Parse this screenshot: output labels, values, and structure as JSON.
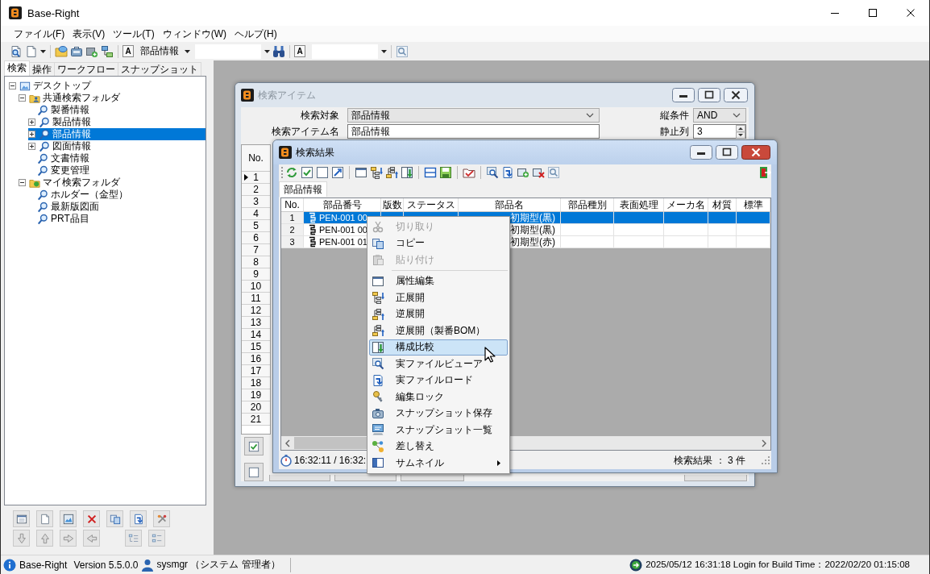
{
  "window": {
    "title": "Base-Right"
  },
  "menu_bar": [
    "ファイル(F)",
    "表示(V)",
    "ツール(T)",
    "ウィンドウ(W)",
    "ヘルプ(H)"
  ],
  "toolbar": {
    "letter_buttons": [
      "A",
      "A"
    ],
    "category_dropdown": "部品情報"
  },
  "side_tabs": [
    {
      "label": "検索",
      "selected": true
    },
    {
      "label": "操作",
      "selected": false
    },
    {
      "label": "ワークフロー",
      "selected": false
    },
    {
      "label": "スナップショット",
      "selected": false
    }
  ],
  "tree": [
    {
      "label": "デスクトップ",
      "kind": "desktop",
      "expanded": true,
      "selected": false,
      "children": [
        {
          "label": "共通検索フォルダ",
          "kind": "shared_folder",
          "expanded": true,
          "selected": false,
          "children": [
            {
              "label": "製番情報",
              "kind": "query",
              "selected": false
            },
            {
              "label": "製品情報",
              "kind": "query",
              "expanded": false,
              "selected": false
            },
            {
              "label": "部品情報",
              "kind": "query",
              "expanded": false,
              "selected": true
            },
            {
              "label": "図面情報",
              "kind": "query",
              "expanded": false,
              "selected": false
            },
            {
              "label": "文書情報",
              "kind": "query",
              "selected": false
            },
            {
              "label": "変更管理",
              "kind": "query",
              "selected": false
            }
          ]
        },
        {
          "label": "マイ検索フォルダ",
          "kind": "my_folder",
          "expanded": true,
          "selected": false,
          "children": [
            {
              "label": "ホルダー（金型）",
              "kind": "query",
              "selected": false
            },
            {
              "label": "最新版図面",
              "kind": "query",
              "selected": false
            },
            {
              "label": "PRT品目",
              "kind": "query",
              "selected": false
            }
          ]
        }
      ]
    }
  ],
  "windows": [
    {
      "kind": "search_item",
      "title": "検索アイテム",
      "active": false,
      "target": {
        "label": "検索対象",
        "value": "部品情報"
      },
      "item_name": {
        "label": "検索アイテム名",
        "value": "部品情報"
      },
      "condition": {
        "label": "縦条件",
        "value": "AND"
      },
      "frozen_columns": {
        "label": "静止列",
        "value": "3"
      },
      "grid": {
        "header": "No.",
        "rows": [
          {
            "number": "1",
            "current": true
          },
          {
            "number": "2",
            "current": false
          },
          {
            "number": "3",
            "current": false
          },
          {
            "number": "4",
            "current": false
          },
          {
            "number": "5",
            "current": false
          },
          {
            "number": "6",
            "current": false
          },
          {
            "number": "7",
            "current": false
          },
          {
            "number": "8",
            "current": false
          },
          {
            "number": "9",
            "current": false
          },
          {
            "number": "10",
            "current": false
          },
          {
            "number": "11",
            "current": false
          },
          {
            "number": "12",
            "current": false
          },
          {
            "number": "13",
            "current": false
          },
          {
            "number": "14",
            "current": false
          },
          {
            "number": "15",
            "current": false
          },
          {
            "number": "16",
            "current": false
          },
          {
            "number": "17",
            "current": false
          },
          {
            "number": "18",
            "current": false
          },
          {
            "number": "19",
            "current": false
          },
          {
            "number": "20",
            "current": false
          },
          {
            "number": "21",
            "current": false
          }
        ]
      }
    },
    {
      "kind": "search_results",
      "title": "検索結果",
      "active": true,
      "tabs": [
        {
          "label": "部品情報",
          "selected": true
        }
      ],
      "columns": [
        "No.",
        "部品番号",
        "版数",
        "ステータス",
        "部品名",
        "部品種別",
        "表面処理",
        "メーカ名",
        "材質",
        "標準"
      ],
      "rows": [
        {
          "no": "1",
          "part_number": "PEN-001 00",
          "part_name": "初期型(黒)",
          "selected": true
        },
        {
          "no": "2",
          "part_number": "PEN-001 00",
          "part_name": "初期型(黒)",
          "selected": false
        },
        {
          "no": "3",
          "part_number": "PEN-001 01",
          "part_name": "初期型(赤)",
          "selected": false
        }
      ],
      "timer": "16:32:11 / 16:32:",
      "result_count": "検索結果 ： 3 件"
    }
  ],
  "context_menu": [
    {
      "kind": "item",
      "label": "切り取り",
      "disabled": true,
      "selected": false,
      "submenu": false
    },
    {
      "kind": "item",
      "label": "コピー",
      "disabled": false,
      "selected": false,
      "submenu": false
    },
    {
      "kind": "item",
      "label": "貼り付け",
      "disabled": true,
      "selected": false,
      "submenu": false
    },
    {
      "kind": "separator"
    },
    {
      "kind": "item",
      "label": "属性編集",
      "disabled": false,
      "selected": false,
      "submenu": false
    },
    {
      "kind": "item",
      "label": "正展開",
      "disabled": false,
      "selected": false,
      "submenu": false
    },
    {
      "kind": "item",
      "label": "逆展開",
      "disabled": false,
      "selected": false,
      "submenu": false
    },
    {
      "kind": "item",
      "label": "逆展開（製番BOM）",
      "disabled": false,
      "selected": false,
      "submenu": false
    },
    {
      "kind": "item",
      "label": "構成比較",
      "disabled": false,
      "selected": true,
      "submenu": false
    },
    {
      "kind": "item",
      "label": "実ファイルビューア",
      "disabled": false,
      "selected": false,
      "submenu": false
    },
    {
      "kind": "item",
      "label": "実ファイルロード",
      "disabled": false,
      "selected": false,
      "submenu": false
    },
    {
      "kind": "item",
      "label": "編集ロック",
      "disabled": false,
      "selected": false,
      "submenu": false
    },
    {
      "kind": "item",
      "label": "スナップショット保存",
      "disabled": false,
      "selected": false,
      "submenu": false
    },
    {
      "kind": "item",
      "label": "スナップショット一覧",
      "disabled": false,
      "selected": false,
      "submenu": false
    },
    {
      "kind": "item",
      "label": "差し替え",
      "disabled": false,
      "selected": false,
      "submenu": false
    },
    {
      "kind": "item",
      "label": "サムネイル",
      "disabled": false,
      "selected": false,
      "submenu": true
    }
  ],
  "status_bar": {
    "app_name": "Base-Right",
    "version": "Version 5.5.0.0",
    "user": "sysmgr （システム 管理者）",
    "login_info": "2025/05/12 16:31:18 Login for Build Time：2022/02/20 01:15:08"
  }
}
